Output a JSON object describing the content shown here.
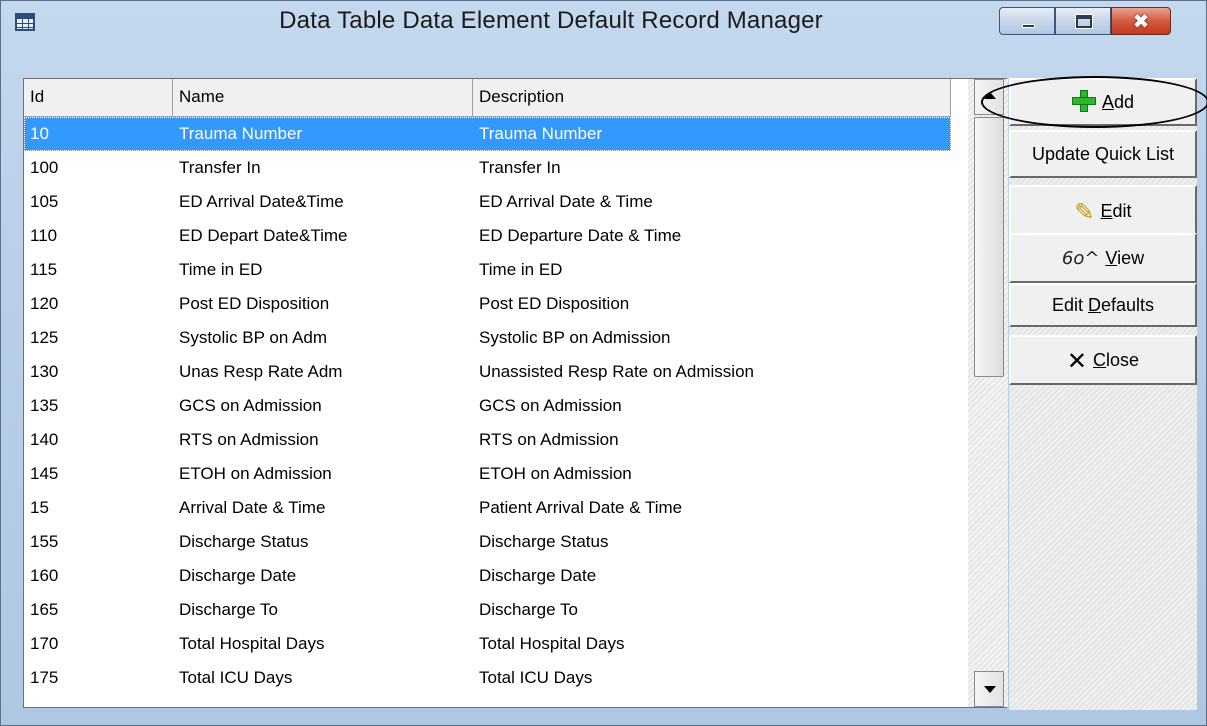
{
  "window": {
    "title": "Data Table Data Element Default Record Manager",
    "close_glyph": "✖"
  },
  "grid": {
    "columns": [
      "Id",
      "Name",
      "Description"
    ],
    "selected_index": 0,
    "rows": [
      {
        "id": "10",
        "name": "Trauma Number",
        "description": "Trauma Number"
      },
      {
        "id": "100",
        "name": "Transfer In",
        "description": "Transfer In"
      },
      {
        "id": "105",
        "name": "ED Arrival Date&Time",
        "description": "ED Arrival Date & Time"
      },
      {
        "id": "110",
        "name": "ED Depart Date&Time",
        "description": "ED Departure Date & Time"
      },
      {
        "id": "115",
        "name": "Time in ED",
        "description": "Time in ED"
      },
      {
        "id": "120",
        "name": "Post ED Disposition",
        "description": "Post ED Disposition"
      },
      {
        "id": "125",
        "name": "Systolic BP on Adm",
        "description": "Systolic BP on Admission"
      },
      {
        "id": "130",
        "name": "Unas Resp Rate Adm",
        "description": "Unassisted Resp Rate on Admission"
      },
      {
        "id": "135",
        "name": "GCS on Admission",
        "description": "GCS on Admission"
      },
      {
        "id": "140",
        "name": "RTS on Admission",
        "description": "RTS on Admission"
      },
      {
        "id": "145",
        "name": "ETOH on Admission",
        "description": "ETOH on Admission"
      },
      {
        "id": "15",
        "name": "Arrival Date & Time",
        "description": "Patient Arrival Date & Time"
      },
      {
        "id": "155",
        "name": "Discharge Status",
        "description": "Discharge Status"
      },
      {
        "id": "160",
        "name": "Discharge Date",
        "description": "Discharge Date"
      },
      {
        "id": "165",
        "name": "Discharge To",
        "description": "Discharge To"
      },
      {
        "id": "170",
        "name": "Total Hospital Days",
        "description": "Total Hospital Days"
      },
      {
        "id": "175",
        "name": "Total ICU Days",
        "description": "Total ICU Days"
      }
    ]
  },
  "buttons": {
    "add": {
      "mnemonic": "A",
      "rest": "dd",
      "icon": "plus-icon"
    },
    "update_quick_list": {
      "label": "Update Quick List"
    },
    "edit": {
      "mnemonic": "E",
      "rest": "dit",
      "icon": "pencil-icon",
      "glyph": "✎"
    },
    "view": {
      "mnemonic": "V",
      "rest": "iew",
      "icon": "glasses-icon",
      "glyph": "6o^"
    },
    "edit_defaults": {
      "prefix": "Edit ",
      "mnemonic": "D",
      "rest": "efaults"
    },
    "close": {
      "mnemonic": "C",
      "rest": "lose",
      "icon": "x-icon",
      "glyph": "✕"
    }
  },
  "colors": {
    "selection": "#3399ff",
    "title_bar": "#b9cfe8"
  }
}
